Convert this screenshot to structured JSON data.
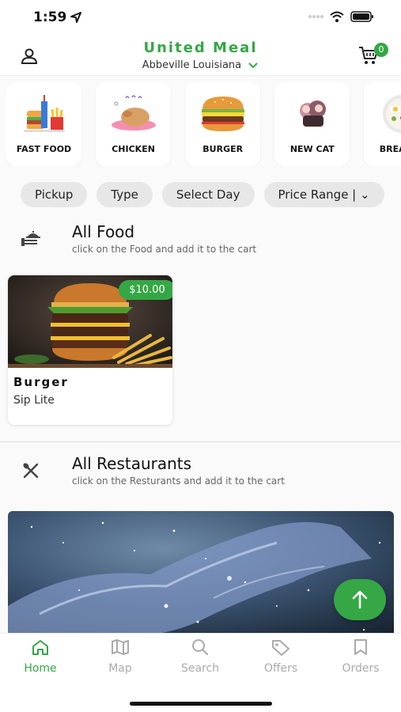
{
  "status": {
    "time": "1:59"
  },
  "header": {
    "title": "United Meal",
    "location": "Abbeville Louisiana",
    "cart_count": "0"
  },
  "categories": [
    {
      "label": "FAST FOOD",
      "icon": "fast-food-icon"
    },
    {
      "label": "CHICKEN",
      "icon": "chicken-icon"
    },
    {
      "label": "BURGER",
      "icon": "burger-icon"
    },
    {
      "label": "NEW CAT",
      "icon": "new-cat-icon"
    },
    {
      "label": "BREAKFA",
      "icon": "breakfast-icon"
    }
  ],
  "filters": [
    "Pickup",
    "Type",
    "Select Day",
    "Price Range  |  ⌄"
  ],
  "all_food": {
    "title": "All Food",
    "subtitle": "click on the Food and add it to the cart",
    "items": [
      {
        "name": "Burger",
        "restaurant": "Sip Lite",
        "price": "$10.00"
      }
    ]
  },
  "all_restaurants": {
    "title": "All Restaurants",
    "subtitle": "click on the Resturants and add it to the cart"
  },
  "tabs": [
    {
      "label": "Home",
      "icon": "home-icon",
      "active": true
    },
    {
      "label": "Map",
      "icon": "map-icon",
      "active": false
    },
    {
      "label": "Search",
      "icon": "search-icon",
      "active": false
    },
    {
      "label": "Offers",
      "icon": "tag-icon",
      "active": false
    },
    {
      "label": "Orders",
      "icon": "bookmark-icon",
      "active": false
    }
  ],
  "colors": {
    "accent": "#35a745",
    "chip": "#e7e7e7",
    "inactive": "#aaaaaa"
  }
}
